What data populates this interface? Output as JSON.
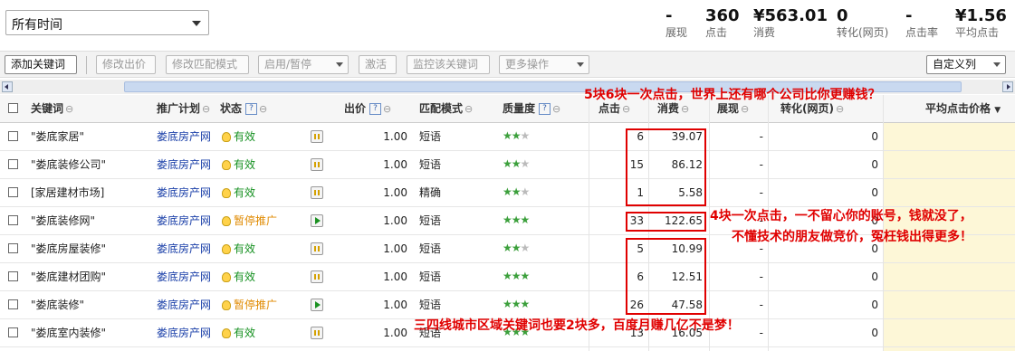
{
  "time_filter": {
    "label": "所有时间"
  },
  "stats": [
    {
      "value": "-",
      "label": "展现"
    },
    {
      "value": "360",
      "label": "点击"
    },
    {
      "value": "¥563.01",
      "label": "消费"
    },
    {
      "value": "0",
      "label": "转化(网页)"
    },
    {
      "value": "-",
      "label": "点击率"
    },
    {
      "value": "¥1.56",
      "label": "平均点击"
    }
  ],
  "toolbar": {
    "add_keyword": "添加关键词",
    "edit_bid": "修改出价",
    "edit_match": "修改匹配模式",
    "enable_pause": "启用/暂停",
    "activate": "激活",
    "monitor": "监控该关键词",
    "more": "更多操作",
    "custom_cols": "自定义列"
  },
  "headers": {
    "keyword": "关键词",
    "plan": "推广计划",
    "status": "状态",
    "bid": "出价",
    "match": "匹配模式",
    "quality": "质量度",
    "clicks": "点击",
    "cost": "消费",
    "impressions": "展现",
    "conversions": "转化(网页)",
    "avg_cpc": "平均点击价格"
  },
  "rows": [
    {
      "keyword": "\"娄底家居\"",
      "plan": "娄底房产网",
      "status": "有效",
      "status_type": "ok",
      "bid": "1.00",
      "match": "短语",
      "quality": 2,
      "clicks": "6",
      "cost": "39.07",
      "impressions": "-",
      "conversions": "0"
    },
    {
      "keyword": "\"娄底装修公司\"",
      "plan": "娄底房产网",
      "status": "有效",
      "status_type": "ok",
      "bid": "1.00",
      "match": "短语",
      "quality": 2,
      "clicks": "15",
      "cost": "86.12",
      "impressions": "-",
      "conversions": "0"
    },
    {
      "keyword": "[家居建材市场]",
      "plan": "娄底房产网",
      "status": "有效",
      "status_type": "ok",
      "bid": "1.00",
      "match": "精确",
      "quality": 2,
      "clicks": "1",
      "cost": "5.58",
      "impressions": "-",
      "conversions": "0"
    },
    {
      "keyword": "\"娄底装修网\"",
      "plan": "娄底房产网",
      "status": "暂停推广",
      "status_type": "pause",
      "bid": "1.00",
      "match": "短语",
      "quality": 3,
      "clicks": "33",
      "cost": "122.65",
      "impressions": "-",
      "conversions": "0"
    },
    {
      "keyword": "\"娄底房屋装修\"",
      "plan": "娄底房产网",
      "status": "有效",
      "status_type": "ok",
      "bid": "1.00",
      "match": "短语",
      "quality": 2,
      "clicks": "5",
      "cost": "10.99",
      "impressions": "-",
      "conversions": "0"
    },
    {
      "keyword": "\"娄底建材团购\"",
      "plan": "娄底房产网",
      "status": "有效",
      "status_type": "ok",
      "bid": "1.00",
      "match": "短语",
      "quality": 3,
      "clicks": "6",
      "cost": "12.51",
      "impressions": "-",
      "conversions": "0"
    },
    {
      "keyword": "\"娄底装修\"",
      "plan": "娄底房产网",
      "status": "暂停推广",
      "status_type": "pause",
      "bid": "1.00",
      "match": "短语",
      "quality": 3,
      "clicks": "26",
      "cost": "47.58",
      "impressions": "-",
      "conversions": "0"
    },
    {
      "keyword": "\"娄底室内装修\"",
      "plan": "娄底房产网",
      "status": "有效",
      "status_type": "ok",
      "bid": "1.00",
      "match": "短语",
      "quality": 3,
      "clicks": "13",
      "cost": "16.05",
      "impressions": "-",
      "conversions": "0"
    }
  ],
  "annotations": {
    "a1": "5块6块一次点击，世界上还有哪个公司比你更赚钱？",
    "a2": "4块一次点击，一不留心你的账号，钱就没了，",
    "a3": "不懂技术的朋友做竞价，冤枉钱出得更多！",
    "a4": "三四线城市区域关键词也要2块多，百度月赚几亿不是梦！"
  },
  "colors": {
    "annotation": "#e00000",
    "plan_link": "#1a3fa8",
    "status_ok": "#159020",
    "status_pause": "#e08a00",
    "highlight_col": "#fdf7d7"
  }
}
